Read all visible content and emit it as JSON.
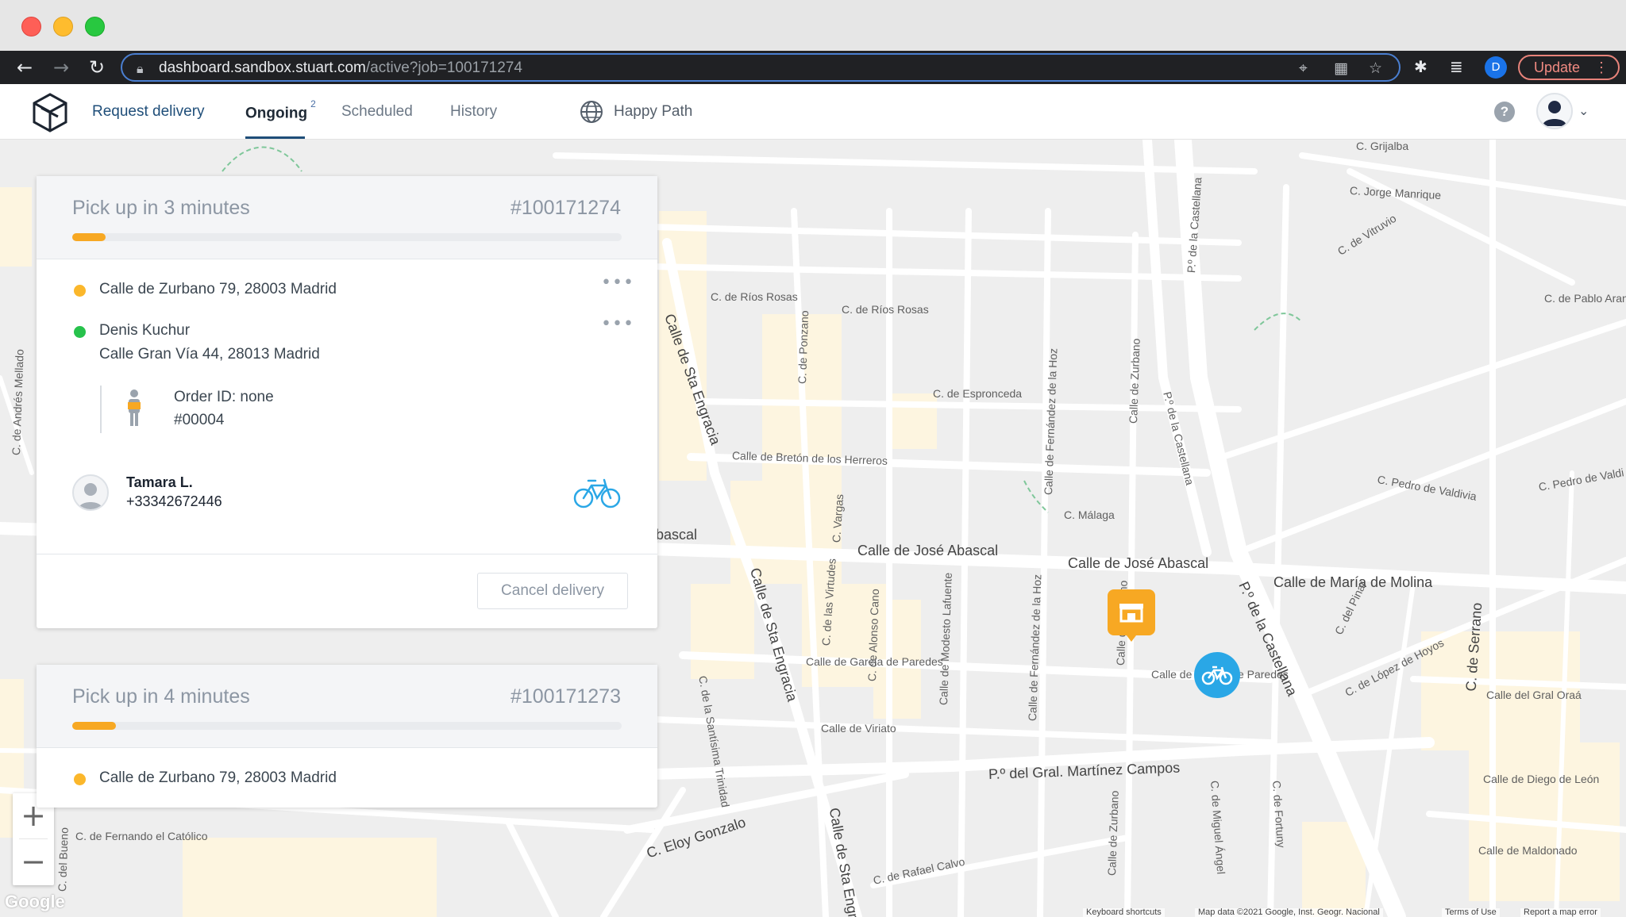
{
  "browser": {
    "url_host": "dashboard.sandbox.stuart.com",
    "url_path": "/active?job=100171274",
    "profile_initial": "D",
    "update_label": "Update"
  },
  "app": {
    "nav": {
      "request_delivery": "Request delivery",
      "ongoing": "Ongoing",
      "ongoing_count": "2",
      "scheduled": "Scheduled",
      "history": "History"
    },
    "workspace_name": "Happy Path",
    "help_label": "?"
  },
  "deliveries": [
    {
      "title": "Pick up in 3 minutes",
      "job_id": "#100171274",
      "progress": 0.06,
      "pickup_address": "Calle de Zurbano 79, 28003 Madrid",
      "recipient_name": "Denis Kuchur",
      "dropoff_address": "Calle Gran Vía 44, 28013 Madrid",
      "order_id": "Order ID: none",
      "order_ref": "#00004",
      "courier_name": "Tamara L.",
      "courier_phone": "+33342672446",
      "cancel_label": "Cancel delivery"
    },
    {
      "title": "Pick up in 4 minutes",
      "job_id": "#100171273",
      "progress": 0.08,
      "pickup_address": "Calle de Zurbano 79, 28003 Madrid"
    }
  ],
  "map": {
    "zoom_in": "+",
    "zoom_out": "−",
    "google": "Google",
    "attribution": {
      "shortcuts": "Keyboard shortcuts",
      "data": "Map data ©2021 Google, Inst. Geogr. Nacional",
      "terms": "Terms of Use",
      "report": "Report a map error"
    },
    "streets": {
      "jose_abascal_1": "Calle de José Abascal",
      "jose_abascal_2": "Calle de José Abascal",
      "abascal_left": "bascal",
      "maria_molina": "Calle de María de Molina",
      "martinez_campos": "P.º del Gral. Martínez Campos",
      "breton": "Calle de Bretón de los Herreros",
      "rios_rosas_1": "C. de Ríos Rosas",
      "rios_rosas_2": "C. de Ríos Rosas",
      "espronceda": "C. de Espronceda",
      "malaga": "C. Málaga",
      "garcia_paredes_1": "Calle de García de Paredes",
      "garcia_paredes_2": "Calle de García de Paredes",
      "viriato": "Calle de Viriato",
      "eloy_gonzalo": "C. Eloy Gonzalo",
      "rafael_calvo": "C. de Rafael Calvo",
      "fernando_catolico": "C. de Fernando el Católico",
      "grijalba": "C. Grijalba",
      "jorge_manrique": "C. Jorge Manrique",
      "pablo_aranda": "C. de Pablo Aran",
      "pedro_valdivia_1": "C. Pedro de Valdivia",
      "pedro_valdivia_2": "C. Pedro de Valdi",
      "gral_oraa": "Calle del Gral Oraá",
      "diego_leon": "Calle de Diego de León",
      "maldonado": "Calle de Maldonado",
      "castellana_1": "P.º de la Castellana",
      "castellana_2": "P.º de la Castellana",
      "castellana_3": "P.º de la Castellana",
      "sta_engracia_1": "Calle de Sta Engracia",
      "sta_engracia_2": "Calle de Sta Engracia",
      "sta_engracia_3": "Calle de Sta Engracia",
      "zurbano_1": "Calle de Zurbano",
      "zurbano_2": "Calle de Zurbano",
      "zurbano_3": "Calle de Zurbano",
      "fernandez_hoz_1": "Calle de Fernández de la Hoz",
      "fernandez_hoz_2": "Calle de Fernández de la Hoz",
      "modesto_lafuente": "Calle de Modesto Lafuente",
      "alonso_cano": "C. de Alonso Cano",
      "virtudes": "C. de las Virtudes",
      "vargas": "C. Vargas",
      "ponzano": "C. de Ponzano",
      "santisima_trinidad": "C. de la Santísima Trinidad",
      "serrano": "C. de Serrano",
      "lopez_hoyos": "C. de López de Hoyos",
      "del_pinar": "C. del Pinar",
      "miguel_angel": "C. de Miguel Ángel",
      "fortuny": "C. de Fortuny",
      "vitruvio": "C. de Vitruvio",
      "andres_mellado": "C. de Andrés Mellado",
      "bueno": "C. del Bueno"
    }
  }
}
